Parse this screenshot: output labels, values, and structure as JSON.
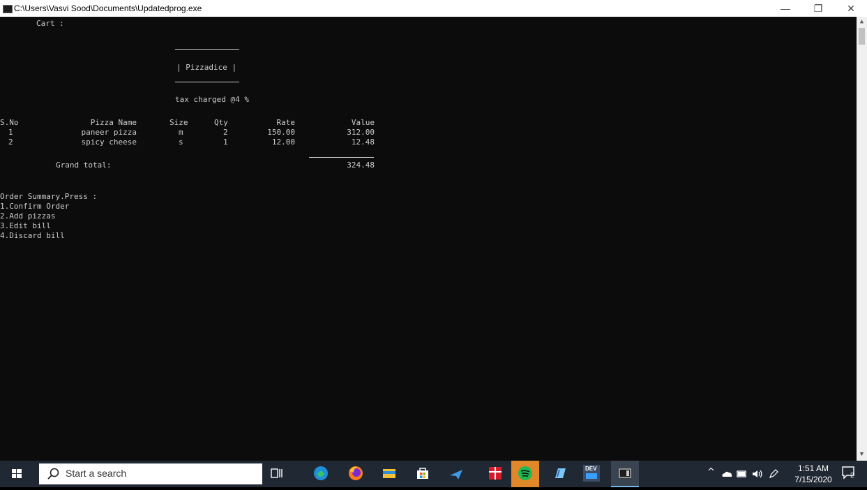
{
  "window": {
    "title": "C:\\Users\\Vasvi Sood\\Documents\\Updatedprog.exe",
    "minimize": "—",
    "maximize": "❐",
    "close": "✕"
  },
  "console": {
    "cart_label": "Cart :",
    "shop_name": "| Pizzadice |",
    "tax_line": "tax charged @4 %",
    "columns": [
      "S.No",
      "Pizza Name",
      "Size",
      "Qty",
      "Rate",
      "Value"
    ],
    "rows": [
      [
        "1",
        "paneer pizza",
        "m",
        "2",
        "150.00",
        "312.00"
      ],
      [
        "2",
        "spicy cheese",
        "s",
        "1",
        "12.00",
        "12.48"
      ]
    ],
    "grand_total_label": "Grand total:",
    "grand_total_value": "324.48",
    "menu_title": "Order Summary.Press :",
    "menu_options": [
      "1.Confirm Order",
      "2.Add pizzas",
      "3.Edit bill",
      "4.Discard bill"
    ]
  },
  "scrollbar": {
    "up": "▲",
    "down": "▼"
  },
  "taskbar": {
    "search_placeholder": "Start a search",
    "apps": [
      "task-view-icon",
      "edge-icon",
      "firefox-icon",
      "file-explorer-icon",
      "store-icon",
      "app-arrow-icon",
      "gift-icon",
      "spotify-icon",
      "notes-icon",
      "dev-cpp-icon",
      "console-window-icon"
    ],
    "dev_label": "DEV",
    "tray": {
      "chevron": "^",
      "time": "1:51 AM",
      "date": "7/15/2020",
      "notifications": "2"
    }
  }
}
